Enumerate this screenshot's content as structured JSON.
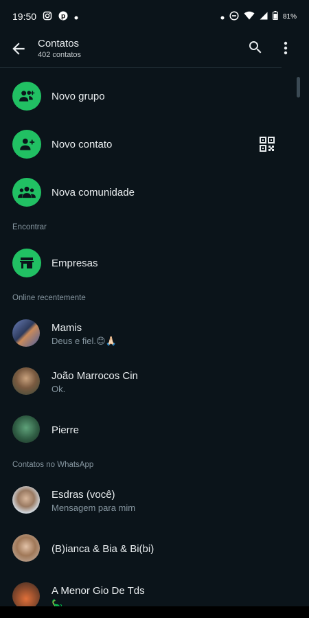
{
  "status_bar": {
    "time": "19:50",
    "battery": "81%"
  },
  "header": {
    "title": "Contatos",
    "subtitle": "402 contatos"
  },
  "actions": [
    {
      "label": "Novo grupo",
      "icon": "group-add-icon"
    },
    {
      "label": "Novo contato",
      "icon": "person-add-icon"
    },
    {
      "label": "Nova comunidade",
      "icon": "community-icon"
    }
  ],
  "sections": {
    "find": "Encontrar",
    "recent": "Online recentemente",
    "whatsapp": "Contatos no WhatsApp"
  },
  "business": {
    "label": "Empresas",
    "icon": "storefront-icon"
  },
  "recent_contacts": [
    {
      "name": "Mamis",
      "status": "Deus e fiel.😊🙏🏻"
    },
    {
      "name": "João Marrocos Cin",
      "status": "Ok."
    },
    {
      "name": "Pierre",
      "status": ""
    }
  ],
  "whatsapp_contacts": [
    {
      "name": "Esdras (você)",
      "status": "Mensagem para mim"
    },
    {
      "name": "(B)ianca & Bia & Bi(bi)",
      "status": ""
    },
    {
      "name": "A Menor Gio De Tds",
      "status": "🦕"
    }
  ],
  "colors": {
    "accent": "#21c063",
    "background": "#0b141a",
    "secondary_text": "#8696a0"
  }
}
